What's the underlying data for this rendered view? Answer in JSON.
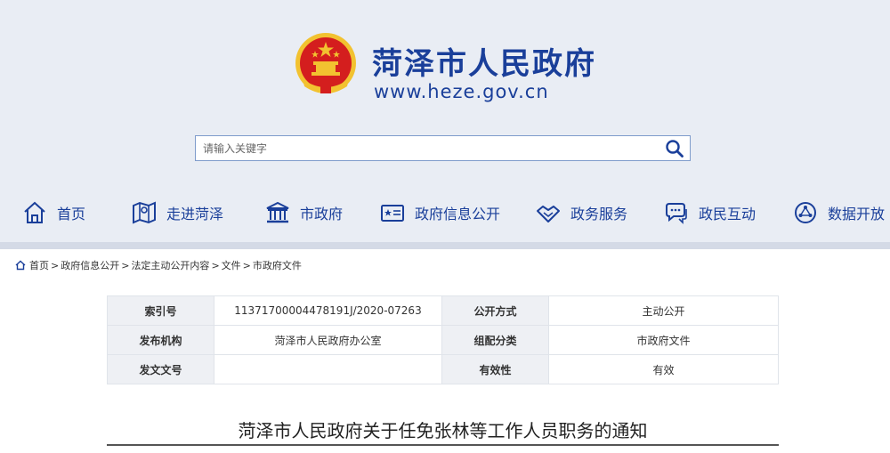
{
  "header": {
    "site_title": "菏泽市人民政府",
    "site_url": "www.heze.gov.cn"
  },
  "search": {
    "placeholder": "请输入关键字"
  },
  "nav": {
    "items": [
      {
        "label": "首页",
        "icon": "home-icon"
      },
      {
        "label": "走进菏泽",
        "icon": "map-icon"
      },
      {
        "label": "市政府",
        "icon": "government-building-icon"
      },
      {
        "label": "政府信息公开",
        "icon": "info-public-icon"
      },
      {
        "label": "政务服务",
        "icon": "handshake-icon"
      },
      {
        "label": "政民互动",
        "icon": "chat-icon"
      },
      {
        "label": "数据开放",
        "icon": "data-icon"
      }
    ]
  },
  "breadcrumb": {
    "items": [
      "首页",
      "政府信息公开",
      "法定主动公开内容",
      "文件",
      "市政府文件"
    ],
    "separator": ">"
  },
  "meta": {
    "rows": [
      {
        "k1": "索引号",
        "v1": "11371700004478191J/2020-07263",
        "k2": "公开方式",
        "v2": "主动公开"
      },
      {
        "k1": "发布机构",
        "v1": "菏泽市人民政府办公室",
        "k2": "组配分类",
        "v2": "市政府文件"
      },
      {
        "k1": "发文文号",
        "v1": "",
        "k2": "有效性",
        "v2": "有效"
      }
    ]
  },
  "document": {
    "title": "菏泽市人民政府关于任免张林等工作人员职务的通知"
  },
  "colors": {
    "brand_blue": "#1a3f9a",
    "header_bg": "#e9edf4",
    "emblem_red": "#d41e1e",
    "emblem_gold": "#f2c230"
  }
}
